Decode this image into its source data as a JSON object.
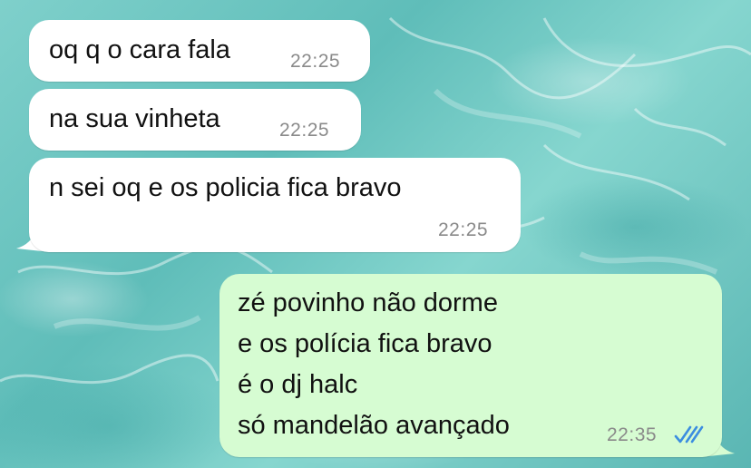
{
  "chat": {
    "messages": [
      {
        "direction": "incoming",
        "text": "oq q o cara fala",
        "time": "22:25"
      },
      {
        "direction": "incoming",
        "text": "na sua vinheta",
        "time": "22:25"
      },
      {
        "direction": "incoming",
        "text": "n sei oq e os policia fica bravo",
        "time": "22:25"
      },
      {
        "direction": "outgoing",
        "lines": [
          "zé povinho não dorme",
          "e os polícia fica bravo",
          "é o dj halc",
          "só mandelão avançado"
        ],
        "time": "22:35",
        "status_icon": "double-check-read-icon"
      }
    ]
  },
  "colors": {
    "incoming_bubble": "#ffffff",
    "outgoing_bubble": "#d6fcd2",
    "read_ticks": "#3b8de0",
    "timestamp": "#8a8a8a"
  }
}
